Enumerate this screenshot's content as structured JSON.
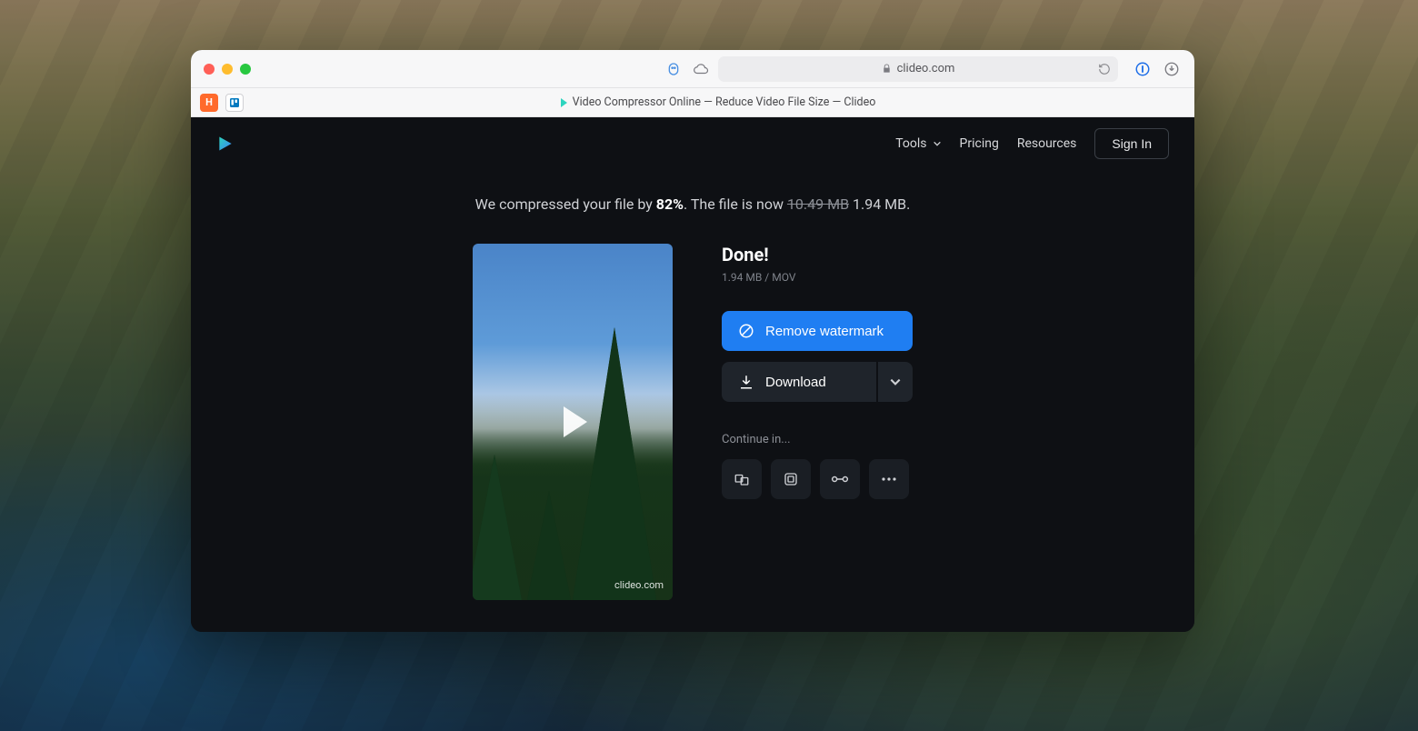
{
  "browser": {
    "url_display": "clideo.com",
    "tab_title": "Video Compressor Online — Reduce Video File Size — Clideo"
  },
  "nav": {
    "tools": "Tools",
    "pricing": "Pricing",
    "resources": "Resources",
    "sign_in": "Sign In"
  },
  "summary": {
    "prefix": "We compressed your file by ",
    "percent": "82%",
    "mid": ". The file is now ",
    "old_size": "10.49 MB",
    "new_size": " 1.94 MB."
  },
  "result": {
    "done": "Done!",
    "meta_size": "1.94 MB",
    "meta_sep": "  /  ",
    "meta_fmt": "MOV",
    "remove_watermark": "Remove watermark",
    "download": "Download",
    "continue_label": "Continue in...",
    "watermark_site": "clideo.com"
  }
}
